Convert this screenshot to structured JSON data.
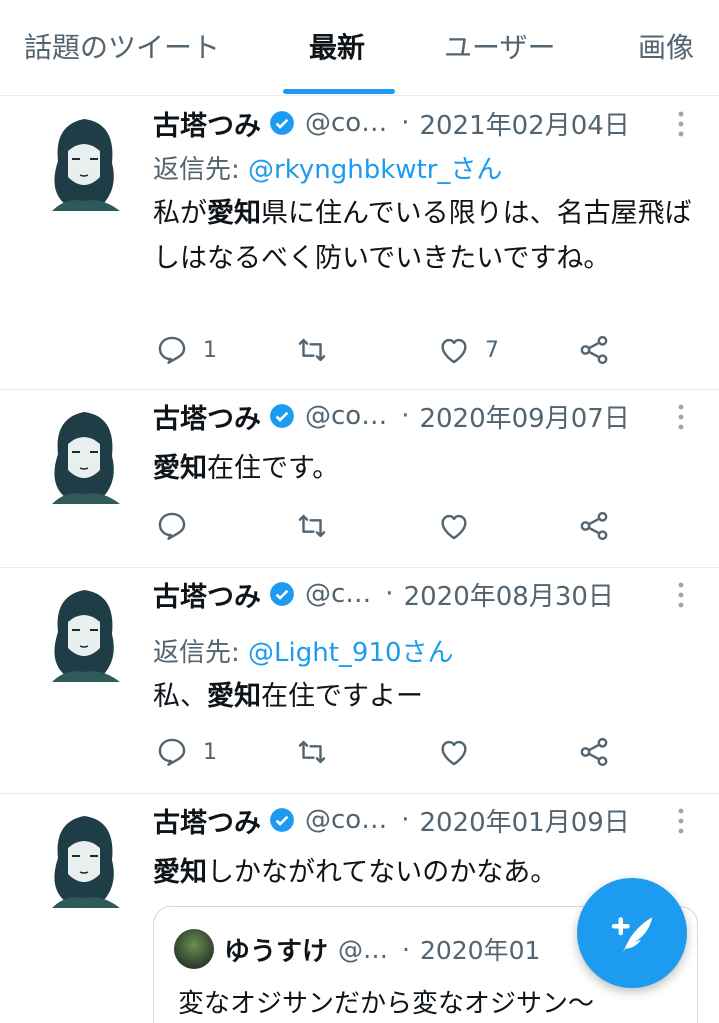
{
  "tabs": [
    {
      "label": "話題のツイート",
      "active": false
    },
    {
      "label": "最新",
      "active": true
    },
    {
      "label": "ユーザー",
      "active": false
    },
    {
      "label": "画像",
      "active": false
    }
  ],
  "tweets": [
    {
      "name": "古塔つみ",
      "handle": "@co…",
      "dot": "·",
      "date": "2021年02月04日",
      "reply_prefix": "返信先: ",
      "reply_mention": "@rkynghbkwtr_さん",
      "text_parts": [
        "私が",
        "愛知",
        "県に住んでいる限りは、名古屋飛ばしはなるべく防いでいきたいですね。"
      ],
      "reply_count": "1",
      "like_count": "7"
    },
    {
      "name": "古塔つみ",
      "handle": "@co…",
      "dot": "·",
      "date": "2020年09月07日",
      "text_parts": [
        "",
        "愛知",
        "在住です。"
      ],
      "reply_count": "",
      "like_count": ""
    },
    {
      "name": "古塔つみ",
      "handle": "@c…",
      "dot": "·",
      "date": "2020年08月30日",
      "reply_prefix": "返信先: ",
      "reply_mention": "@Light_910さん",
      "text_parts": [
        "私、",
        "愛知",
        "在住ですよー"
      ],
      "reply_count": "1",
      "like_count": ""
    },
    {
      "name": "古塔つみ",
      "handle": "@co…",
      "dot": "·",
      "date": "2020年01月09日",
      "text_parts": [
        "",
        "愛知",
        "しかながれてないのかなあ。"
      ],
      "quote": {
        "name": "ゆうすけ",
        "handle": "@…",
        "dot": "·",
        "date": "2020年01",
        "text": "変なオジサンだから変なオジサン〜"
      }
    }
  ],
  "icons": {
    "verified": "verified-badge-icon",
    "more": "more-vertical-icon",
    "reply": "reply-icon",
    "retweet": "retweet-icon",
    "like": "heart-icon",
    "share": "share-icon",
    "compose": "compose-tweet-icon"
  },
  "colors": {
    "accent": "#1d9bf0",
    "text": "#0f1419",
    "secondary": "#536471"
  }
}
